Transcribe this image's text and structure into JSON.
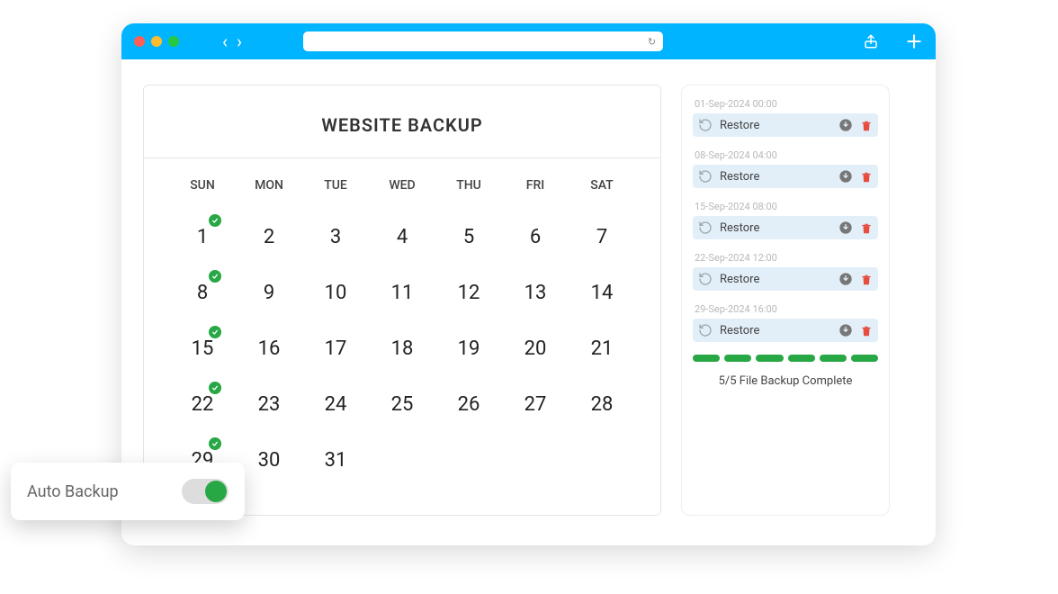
{
  "browser": {
    "traffic": [
      "red",
      "yellow",
      "green"
    ]
  },
  "calendar": {
    "title": "WEBSITE BACKUP",
    "dow": [
      "SUN",
      "MON",
      "TUE",
      "WED",
      "THU",
      "FRI",
      "SAT"
    ],
    "weeks": [
      [
        {
          "n": "1",
          "check": true
        },
        {
          "n": "2"
        },
        {
          "n": "3"
        },
        {
          "n": "4"
        },
        {
          "n": "5"
        },
        {
          "n": "6"
        },
        {
          "n": "7"
        }
      ],
      [
        {
          "n": "8",
          "check": true
        },
        {
          "n": "9"
        },
        {
          "n": "10"
        },
        {
          "n": "11"
        },
        {
          "n": "12"
        },
        {
          "n": "13"
        },
        {
          "n": "14"
        }
      ],
      [
        {
          "n": "15",
          "check": true
        },
        {
          "n": "16"
        },
        {
          "n": "17"
        },
        {
          "n": "18"
        },
        {
          "n": "19"
        },
        {
          "n": "20"
        },
        {
          "n": "21"
        }
      ],
      [
        {
          "n": "22",
          "check": true
        },
        {
          "n": "23"
        },
        {
          "n": "24"
        },
        {
          "n": "25"
        },
        {
          "n": "26"
        },
        {
          "n": "27"
        },
        {
          "n": "28"
        }
      ],
      [
        {
          "n": "29",
          "check": true
        },
        {
          "n": "30"
        },
        {
          "n": "31"
        },
        {
          "n": ""
        },
        {
          "n": ""
        },
        {
          "n": ""
        },
        {
          "n": ""
        }
      ]
    ]
  },
  "backups": {
    "items": [
      {
        "ts": "01-Sep-2024 00:00",
        "label": "Restore"
      },
      {
        "ts": "08-Sep-2024 04:00",
        "label": "Restore"
      },
      {
        "ts": "15-Sep-2024 08:00",
        "label": "Restore"
      },
      {
        "ts": "22-Sep-2024 12:00",
        "label": "Restore"
      },
      {
        "ts": "29-Sep-2024 16:00",
        "label": "Restore"
      }
    ],
    "progress_segments": 6,
    "status": "5/5 File Backup Complete"
  },
  "auto_backup": {
    "label": "Auto Backup",
    "on": true
  }
}
